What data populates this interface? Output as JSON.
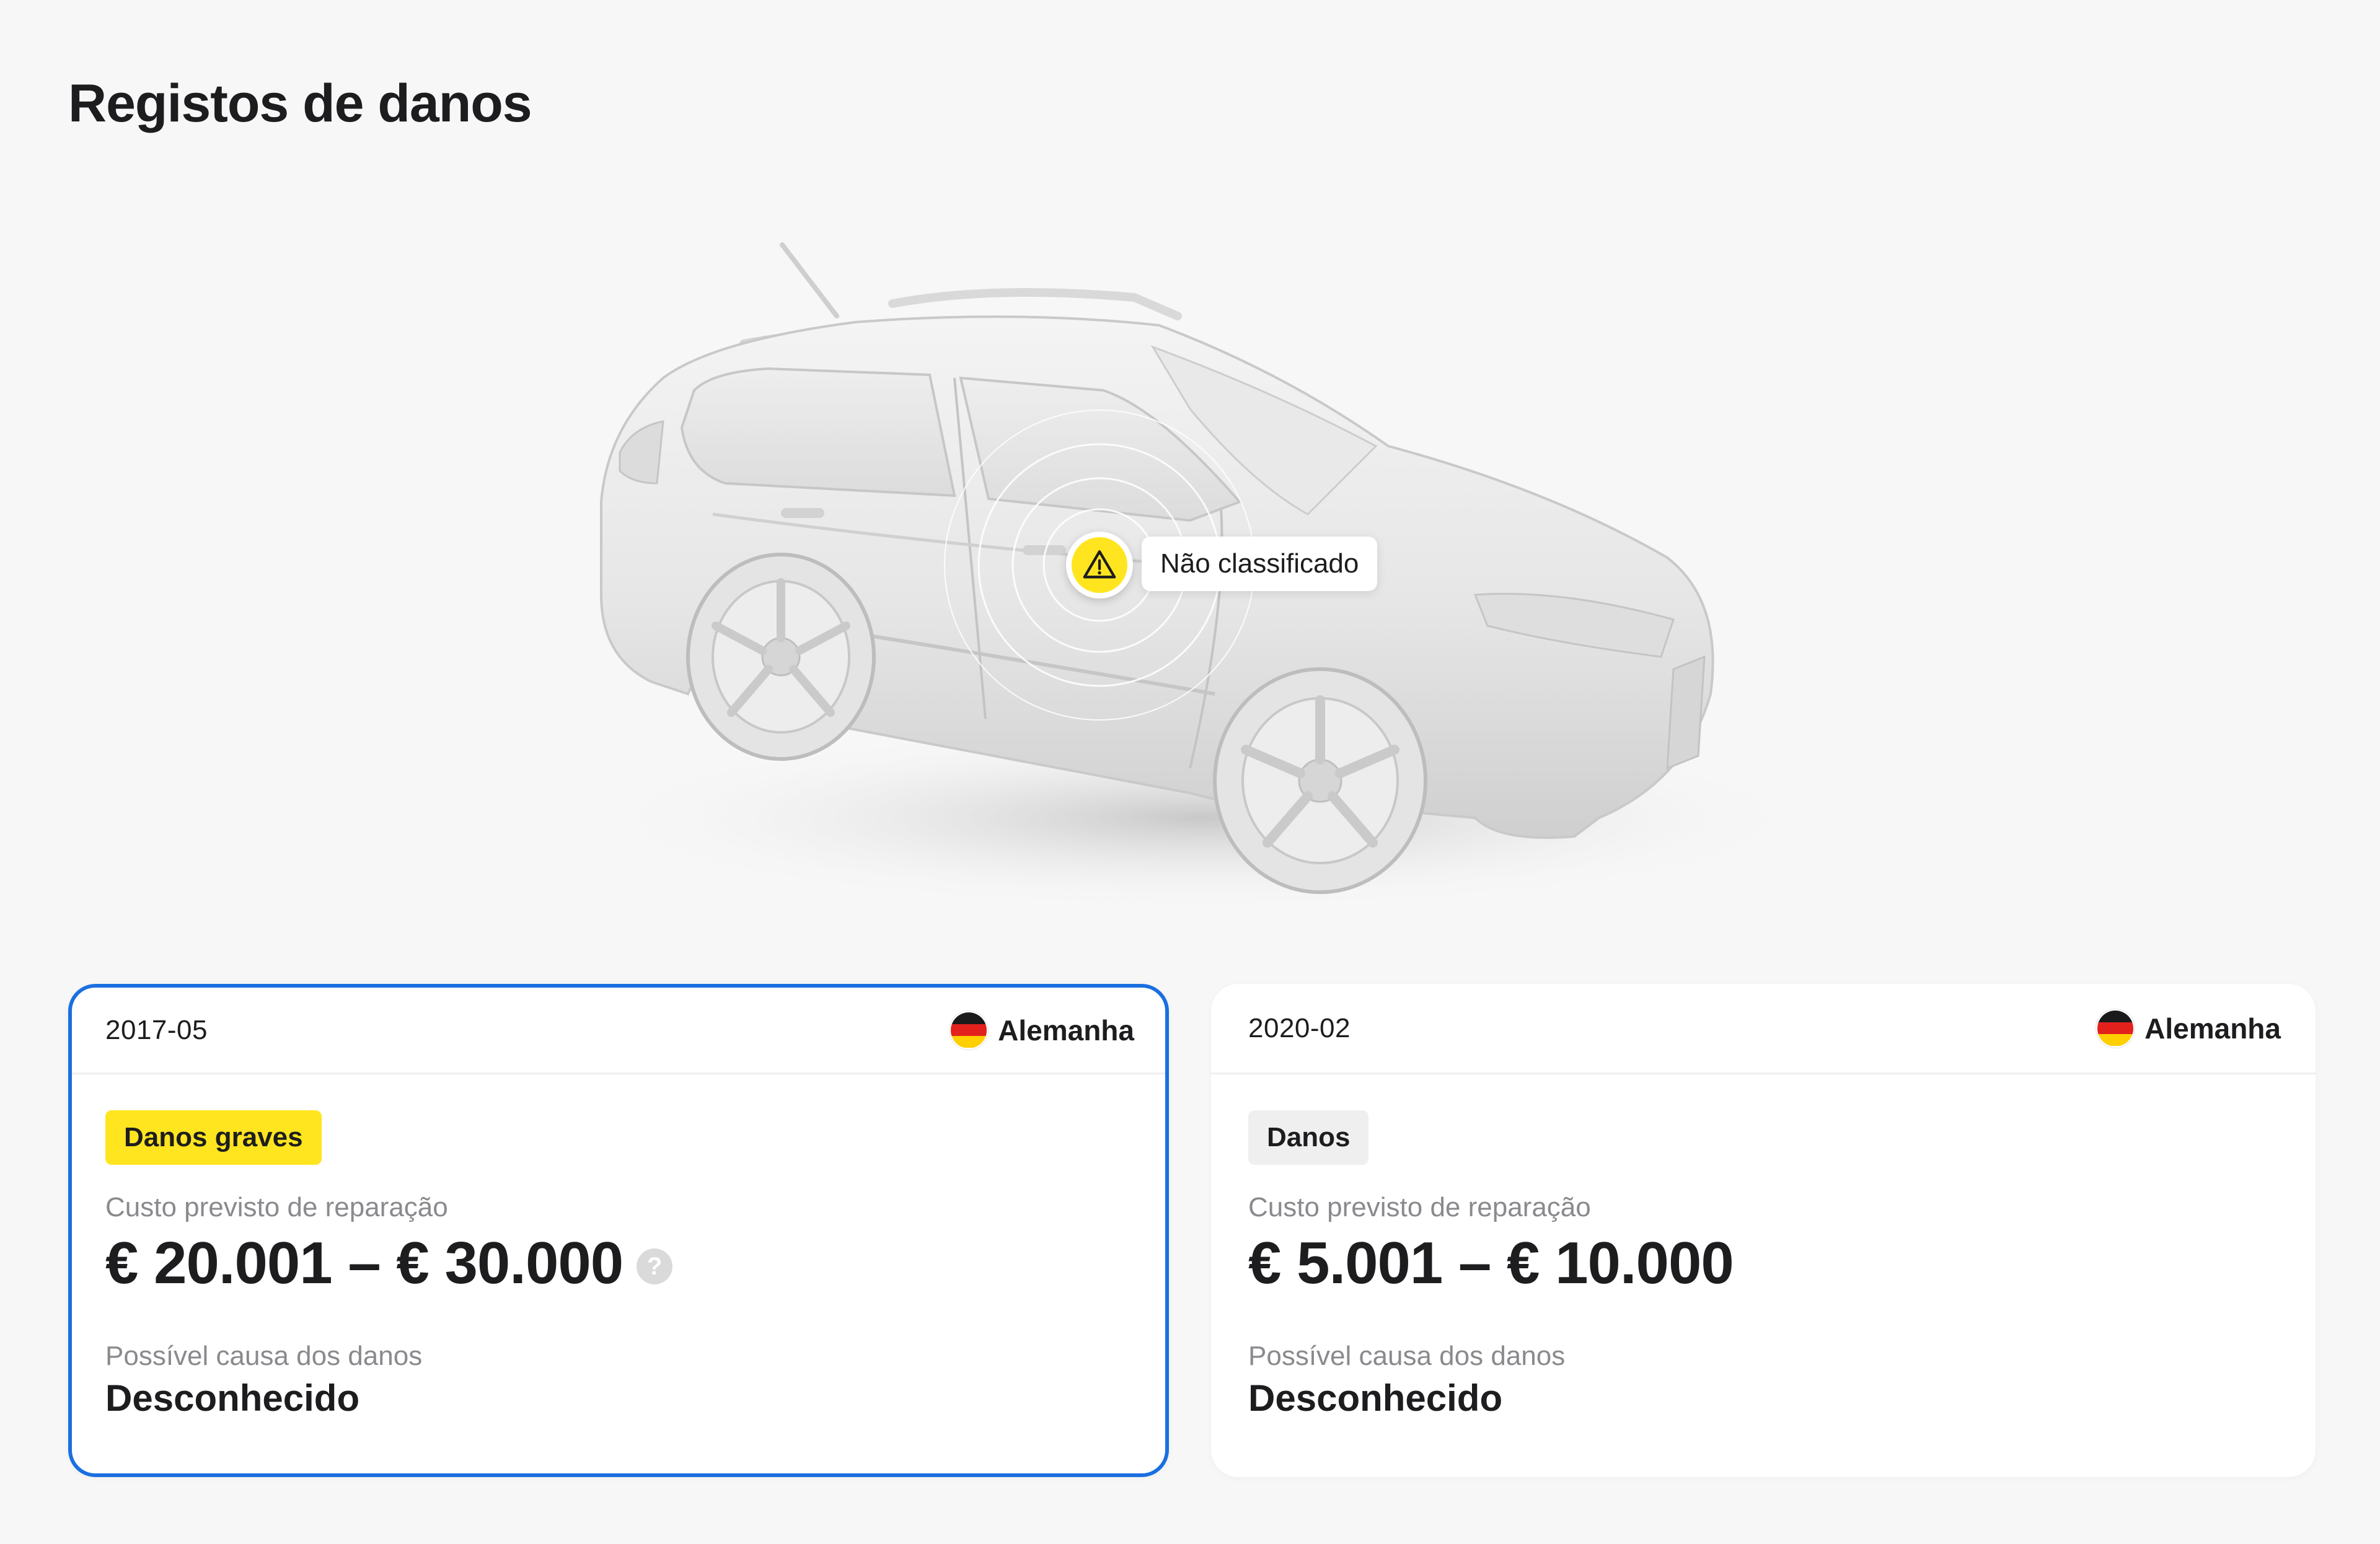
{
  "page": {
    "title": "Registos de danos"
  },
  "damage_marker": {
    "icon": "warning-triangle-icon",
    "label": "Não classificado"
  },
  "colors": {
    "accent_yellow": "#ffe51f",
    "selected_border": "#1a6fe0",
    "badge_neutral": "#efefef"
  },
  "records": [
    {
      "date": "2017-05",
      "country": "Alemanha",
      "country_flag": "germany-flag-icon",
      "severity": "Danos graves",
      "repair_cost_label": "Custo previsto de reparação",
      "repair_cost": "€ 20.001 – € 30.000",
      "help_glyph": "?",
      "cause_label": "Possível causa dos danos",
      "cause": "Desconhecido",
      "selected": true
    },
    {
      "date": "2020-02",
      "country": "Alemanha",
      "country_flag": "germany-flag-icon",
      "severity": "Danos",
      "repair_cost_label": "Custo previsto de reparação",
      "repair_cost": "€ 5.001 – € 10.000",
      "cause_label": "Possível causa dos danos",
      "cause": "Desconhecido",
      "selected": false
    }
  ]
}
